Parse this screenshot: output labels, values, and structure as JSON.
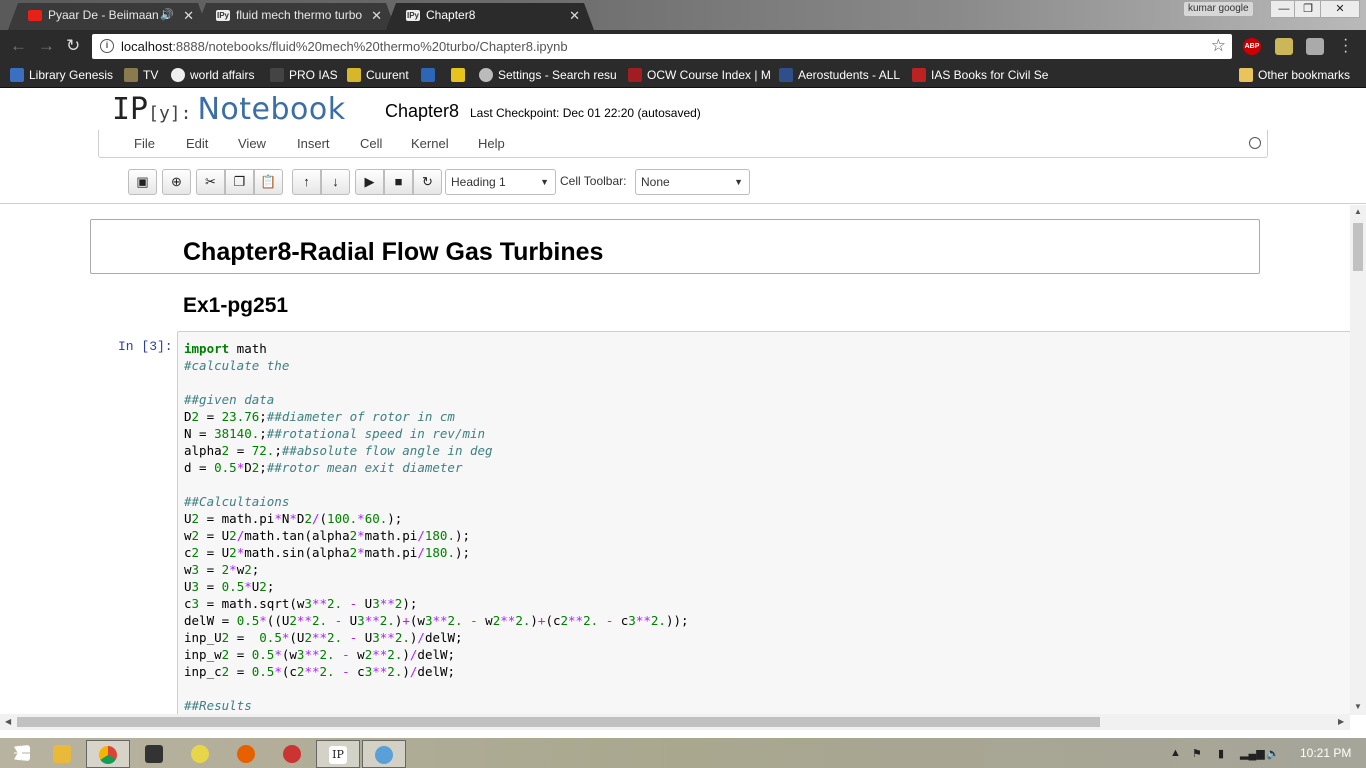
{
  "browser": {
    "tabs": [
      {
        "title": "Pyaar De - Beiimaan L",
        "icon": "youtube-icon",
        "audio": true,
        "active": false
      },
      {
        "title": "fluid mech thermo turbo",
        "icon": "ipython-icon",
        "active": false
      },
      {
        "title": "Chapter8",
        "icon": "ipython-icon",
        "active": true
      }
    ],
    "profile": "kumar google",
    "window_buttons": {
      "minimize": "—",
      "restore": "❐",
      "close": "✕"
    },
    "url_host": "localhost",
    "url_rest": ":8888/notebooks/fluid%20mech%20thermo%20turbo/Chapter8.ipynb",
    "extensions": [
      "ABP"
    ],
    "bookmarks": [
      "Library Genesis",
      "TV",
      "world affairs",
      "PRO IAS",
      "Cuurent",
      "",
      "",
      "Settings - Search resu",
      "OCW Course Index | M",
      "Aerostudents - ALL",
      "IAS Books for Civil Ser"
    ],
    "other_bookmarks": "Other bookmarks"
  },
  "jupyter": {
    "logo_ip": "IP",
    "logo_y": "[y]:",
    "logo_text": "Notebook",
    "notebook_name": "Chapter8",
    "checkpoint": "Last Checkpoint: Dec 01 22:20 (autosaved)",
    "menu": [
      "File",
      "Edit",
      "View",
      "Insert",
      "Cell",
      "Kernel",
      "Help"
    ],
    "cell_type": "Heading 1",
    "celltoolbar_label": "Cell Toolbar:",
    "celltoolbar_value": "None"
  },
  "cells": {
    "heading1": "Chapter8-Radial Flow Gas Turbines",
    "heading2": "Ex1-pg251",
    "prompt": "In [3]:",
    "code_lines": [
      "import math",
      "#calculate the",
      "",
      "##given data",
      "D2 = 23.76;##diameter of rotor in cm",
      "N = 38140.;##rotational speed in rev/min",
      "alpha2 = 72.;##absolute flow angle in deg",
      "d = 0.5*D2;##rotor mean exit diameter",
      "",
      "##Calcultaions",
      "U2 = math.pi*N*D2/(100.*60.);",
      "w2 = U2/math.tan(alpha2*math.pi/180.);",
      "c2 = U2*math.sin(alpha2*math.pi/180.);",
      "w3 = 2*w2;",
      "U3 = 0.5*U2;",
      "c3 = math.sqrt(w3**2. - U3**2);",
      "delW = 0.5*((U2**2. - U3**2.)+(w3**2. - w2**2.)+(c2**2. - c3**2.));",
      "inp_U2 =  0.5*(U2**2. - U3**2.)/delW;",
      "inp_w2 = 0.5*(w3**2. - w2**2.)/delW;",
      "inp_c2 = 0.5*(c2**2. - c3**2.)/delW;",
      "",
      "##Results"
    ]
  },
  "taskbar": {
    "clock": "10:21 PM",
    "pinned": [
      "windows-start-icon",
      "file-explorer-icon",
      "chrome-icon",
      "terminal-icon",
      "media-icon",
      "firefox-icon",
      "paint-icon",
      "ipython-icon",
      "network-icon"
    ]
  },
  "colors": {
    "keyword": "#008000",
    "comment": "#408080",
    "number": "#008000",
    "operator": "#aa22ff",
    "prompt": "#303f9f",
    "logo": "#3b6ea8"
  }
}
